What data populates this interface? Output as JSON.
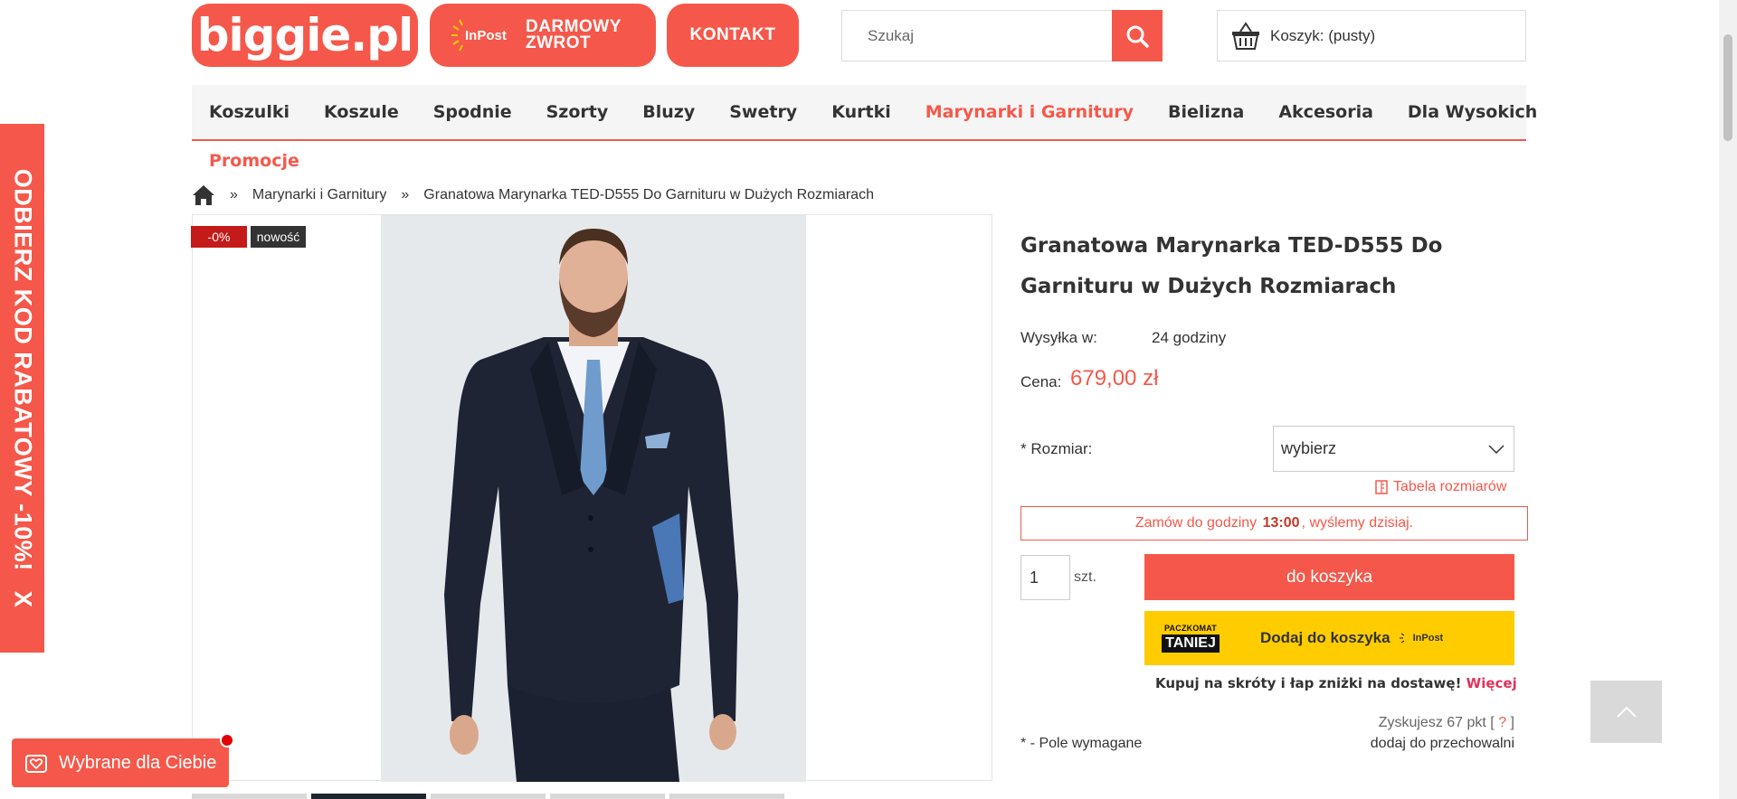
{
  "header": {
    "logo_text": "biggie.pl",
    "inpost_logo_text": "InPost",
    "return_badge_line1": "DARMOWY",
    "return_badge_line2": "ZWROT",
    "contact_label": "KONTAKT",
    "search_placeholder": "Szukaj",
    "cart_text": "Koszyk: (pusty)"
  },
  "nav": {
    "items": [
      "Koszulki",
      "Koszule",
      "Spodnie",
      "Szorty",
      "Bluzy",
      "Swetry",
      "Kurtki",
      "Marynarki i Garnitury",
      "Bielizna",
      "Akcesoria",
      "Dla Wysokich"
    ],
    "active": "Marynarki i Garnitury",
    "promo": "Promocje"
  },
  "breadcrumb": {
    "sep": "»",
    "category": "Marynarki i Garnitury",
    "current": "Granatowa Marynarka TED-D555 Do Garnituru w Dużych Rozmiarach"
  },
  "side_promo": {
    "text": "ODBIERZ KOD RABATOWY -10%!",
    "close": "X"
  },
  "product": {
    "tag_discount": "-0%",
    "tag_new": "nowość",
    "title": "Granatowa Marynarka TED-D555 Do Garnituru w Dużych Rozmiarach",
    "shipping_label": "Wysyłka w:",
    "shipping_value": "24 godziny",
    "price_label": "Cena:",
    "price": "679,00 zł",
    "size_label": "* Rozmiar:",
    "size_select": "wybierz",
    "size_table": "Tabela rozmiarów",
    "order_before": "Zamów do godziny",
    "order_hour": "13:00",
    "order_after": ", wyślemy dzisiaj.",
    "qty": "1",
    "qty_unit": "szt.",
    "add_to_cart": "do koszyka",
    "paczkomat_line1": "PACZKOMAT",
    "paczkomat_line2": "TANIEJ",
    "paczkomat_add": "Dodaj do koszyka",
    "paczkomat_inpost": "InPost",
    "shortcut_text": "Kupuj na skróty i łap zniżki na dostawę!",
    "shortcut_more": "Więcej",
    "points_before": "Zyskujesz 67 pkt [",
    "points_q": "?",
    "points_after": "]",
    "storage": "dodaj do przechowalni",
    "required": "* - Pole wymagane"
  },
  "widget": {
    "chosen_label": "Wybrane dla Ciebie"
  },
  "colors": {
    "accent": "#f5584a",
    "discount_tag": "#c41a1a",
    "paczkomat": "#ffcc00"
  }
}
